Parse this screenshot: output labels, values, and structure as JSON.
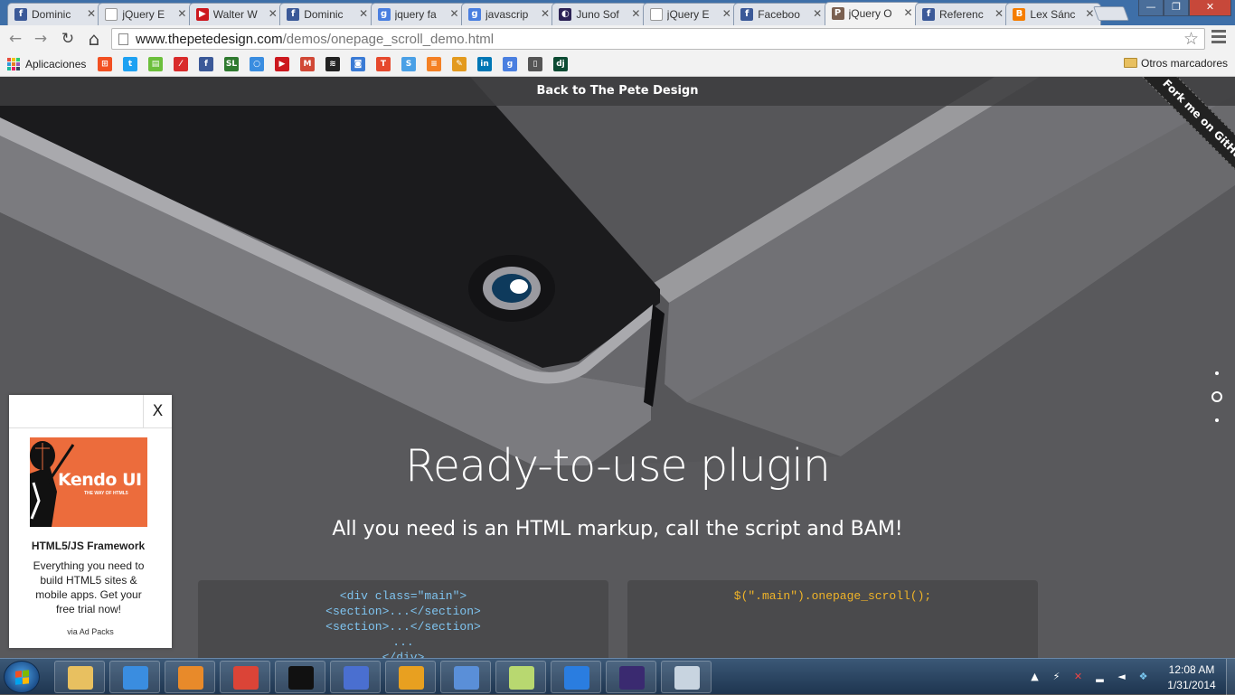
{
  "tabs": [
    {
      "label": "Dominic",
      "favicon": "facebook-icon",
      "color": "#3b5998",
      "glyph": "f"
    },
    {
      "label": "jQuery E",
      "favicon": "page-icon",
      "color": "#ffffff",
      "glyph": ""
    },
    {
      "label": "Walter W",
      "favicon": "youtube-icon",
      "color": "#cc181e",
      "glyph": "▶"
    },
    {
      "label": "Dominic",
      "favicon": "facebook-icon",
      "color": "#3b5998",
      "glyph": "f"
    },
    {
      "label": "jquery fa",
      "favicon": "google-icon",
      "color": "#4a7fe0",
      "glyph": "g"
    },
    {
      "label": "javascrip",
      "favicon": "google-icon",
      "color": "#4a7fe0",
      "glyph": "g"
    },
    {
      "label": "Juno Sof",
      "favicon": "eclipse-icon",
      "color": "#2c2255",
      "glyph": "◐"
    },
    {
      "label": "jQuery E",
      "favicon": "page-icon",
      "color": "#ffffff",
      "glyph": ""
    },
    {
      "label": "Faceboo",
      "favicon": "facebook-icon",
      "color": "#3b5998",
      "glyph": "f"
    },
    {
      "label": "jQuery O",
      "favicon": "pete-icon",
      "color": "#7a6050",
      "glyph": "P",
      "active": true
    },
    {
      "label": "Referenc",
      "favicon": "facebook-icon",
      "color": "#3b5998",
      "glyph": "f"
    },
    {
      "label": "Lex Sánc",
      "favicon": "blogger-icon",
      "color": "#f57d00",
      "glyph": "B"
    }
  ],
  "tab_close_glyph": "✕",
  "window": {
    "minimize": "—",
    "maximize": "❐",
    "close": "✕"
  },
  "nav": {
    "back": "←",
    "forward": "→",
    "reload": "↻",
    "home": "⌂",
    "star": "☆"
  },
  "url": {
    "host": "www.thepetedesign.com",
    "path": "/demos/onepage_scroll_demo.html"
  },
  "bookmarks": {
    "apps_label": "Aplicaciones",
    "apps_colors": [
      "#e74c3c",
      "#f1c40f",
      "#2ecc71",
      "#3498db",
      "#e67e22",
      "#9b59b6",
      "#1abc9c",
      "#e91e63",
      "#34495e"
    ],
    "icons": [
      {
        "name": "windows-bookmark-icon",
        "color": "#f25022",
        "glyph": "⊞"
      },
      {
        "name": "twitter-bookmark-icon",
        "color": "#1da1f2",
        "glyph": "t"
      },
      {
        "name": "green-bookmark-icon",
        "color": "#6cbf3c",
        "glyph": "▤"
      },
      {
        "name": "red-pencil-bookmark-icon",
        "color": "#d92b2b",
        "glyph": "⁄"
      },
      {
        "name": "facebook-bookmark-icon",
        "color": "#3b5998",
        "glyph": "f"
      },
      {
        "name": "software-libre-bookmark-icon",
        "color": "#2f7a2f",
        "glyph": "SL"
      },
      {
        "name": "ring-bookmark-icon",
        "color": "#3a8de0",
        "glyph": "○"
      },
      {
        "name": "youtube-bookmark-icon",
        "color": "#cc181e",
        "glyph": "▶"
      },
      {
        "name": "gmail-bookmark-icon",
        "color": "#d14836",
        "glyph": "M"
      },
      {
        "name": "layers-bookmark-icon",
        "color": "#222222",
        "glyph": "≋"
      },
      {
        "name": "chat-bookmark-icon",
        "color": "#3a7bd5",
        "glyph": "◙"
      },
      {
        "name": "t-bookmark-icon",
        "color": "#e6492d",
        "glyph": "T"
      },
      {
        "name": "s-bookmark-icon",
        "color": "#4aa0e6",
        "glyph": "S"
      },
      {
        "name": "stackoverflow-bookmark-icon",
        "color": "#f48024",
        "glyph": "≡"
      },
      {
        "name": "pen-bookmark-icon",
        "color": "#e39a1e",
        "glyph": "✎"
      },
      {
        "name": "linkedin-bookmark-icon",
        "color": "#0077b5",
        "glyph": "in"
      },
      {
        "name": "google-bookmark-icon",
        "color": "#4a7fe0",
        "glyph": "g"
      },
      {
        "name": "device-bookmark-icon",
        "color": "#555555",
        "glyph": "▯"
      },
      {
        "name": "django-bookmark-icon",
        "color": "#0c4b33",
        "glyph": "dj"
      }
    ],
    "other_label": "Otros marcadores"
  },
  "page": {
    "back_link": "Back to The Pete Design",
    "ribbon": "Fork me on GitHub",
    "title": "Ready-to-use plugin",
    "subtitle": "All you need is an HTML markup, call the script and BAM!",
    "code_left": [
      "<div class=\"main\">",
      "<section>...</section>",
      "<section>...</section>",
      "...",
      "</div>"
    ],
    "code_right": "$(\".main\").onepage_scroll();",
    "pagination": {
      "pages": 3,
      "active": 2
    }
  },
  "ad": {
    "close": "X",
    "brand": "Kendo UI",
    "tagline": "THE WAY OF HTML5",
    "title": "HTML5/JS Framework",
    "body": "Everything you need to build HTML5 sites & mobile apps. Get your free trial now!",
    "via": "via Ad Packs"
  },
  "taskbar": {
    "apps": [
      {
        "name": "explorer-taskbar-button",
        "icon": "folder-icon",
        "color": "#e8c060"
      },
      {
        "name": "ie-taskbar-button",
        "icon": "internet-explorer-icon",
        "color": "#3a8de0"
      },
      {
        "name": "media-player-taskbar-button",
        "icon": "media-player-icon",
        "color": "#e88a2a"
      },
      {
        "name": "chrome-taskbar-button",
        "icon": "chrome-icon",
        "color": "#db4437"
      },
      {
        "name": "cmd-taskbar-button",
        "icon": "terminal-icon",
        "color": "#111111"
      },
      {
        "name": "network-taskbar-button",
        "icon": "network-tool-icon",
        "color": "#4a6fd0"
      },
      {
        "name": "winamp-taskbar-button",
        "icon": "winamp-icon",
        "color": "#e8a020"
      },
      {
        "name": "remote-desktop-taskbar-button",
        "icon": "remote-desktop-icon",
        "color": "#5a8fd8"
      },
      {
        "name": "sticky-notes-taskbar-button",
        "icon": "sticky-notes-icon",
        "color": "#b8d870"
      },
      {
        "name": "circles-taskbar-button",
        "icon": "circles-app-icon",
        "color": "#2a7de0"
      },
      {
        "name": "eclipse-taskbar-button",
        "icon": "eclipse-icon",
        "color": "#3a2a70"
      },
      {
        "name": "calculator-taskbar-button",
        "icon": "calculator-icon",
        "color": "#c8d4e0"
      }
    ],
    "tray": {
      "show_hidden": "▲",
      "power": "⚡",
      "network": "✕",
      "signal": "▂",
      "volume": "◄",
      "dropbox": "❖"
    },
    "time": "12:08 AM",
    "date": "1/31/2014"
  }
}
